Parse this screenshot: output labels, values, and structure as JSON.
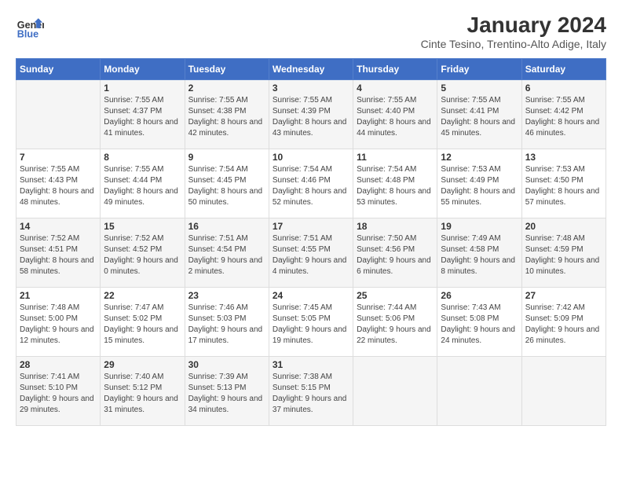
{
  "header": {
    "logo_general": "General",
    "logo_blue": "Blue",
    "month_title": "January 2024",
    "location": "Cinte Tesino, Trentino-Alto Adige, Italy"
  },
  "weekdays": [
    "Sunday",
    "Monday",
    "Tuesday",
    "Wednesday",
    "Thursday",
    "Friday",
    "Saturday"
  ],
  "weeks": [
    [
      {
        "day": "",
        "sunrise": "",
        "sunset": "",
        "daylight": ""
      },
      {
        "day": "1",
        "sunrise": "Sunrise: 7:55 AM",
        "sunset": "Sunset: 4:37 PM",
        "daylight": "Daylight: 8 hours and 41 minutes."
      },
      {
        "day": "2",
        "sunrise": "Sunrise: 7:55 AM",
        "sunset": "Sunset: 4:38 PM",
        "daylight": "Daylight: 8 hours and 42 minutes."
      },
      {
        "day": "3",
        "sunrise": "Sunrise: 7:55 AM",
        "sunset": "Sunset: 4:39 PM",
        "daylight": "Daylight: 8 hours and 43 minutes."
      },
      {
        "day": "4",
        "sunrise": "Sunrise: 7:55 AM",
        "sunset": "Sunset: 4:40 PM",
        "daylight": "Daylight: 8 hours and 44 minutes."
      },
      {
        "day": "5",
        "sunrise": "Sunrise: 7:55 AM",
        "sunset": "Sunset: 4:41 PM",
        "daylight": "Daylight: 8 hours and 45 minutes."
      },
      {
        "day": "6",
        "sunrise": "Sunrise: 7:55 AM",
        "sunset": "Sunset: 4:42 PM",
        "daylight": "Daylight: 8 hours and 46 minutes."
      }
    ],
    [
      {
        "day": "7",
        "sunrise": "Sunrise: 7:55 AM",
        "sunset": "Sunset: 4:43 PM",
        "daylight": "Daylight: 8 hours and 48 minutes."
      },
      {
        "day": "8",
        "sunrise": "Sunrise: 7:55 AM",
        "sunset": "Sunset: 4:44 PM",
        "daylight": "Daylight: 8 hours and 49 minutes."
      },
      {
        "day": "9",
        "sunrise": "Sunrise: 7:54 AM",
        "sunset": "Sunset: 4:45 PM",
        "daylight": "Daylight: 8 hours and 50 minutes."
      },
      {
        "day": "10",
        "sunrise": "Sunrise: 7:54 AM",
        "sunset": "Sunset: 4:46 PM",
        "daylight": "Daylight: 8 hours and 52 minutes."
      },
      {
        "day": "11",
        "sunrise": "Sunrise: 7:54 AM",
        "sunset": "Sunset: 4:48 PM",
        "daylight": "Daylight: 8 hours and 53 minutes."
      },
      {
        "day": "12",
        "sunrise": "Sunrise: 7:53 AM",
        "sunset": "Sunset: 4:49 PM",
        "daylight": "Daylight: 8 hours and 55 minutes."
      },
      {
        "day": "13",
        "sunrise": "Sunrise: 7:53 AM",
        "sunset": "Sunset: 4:50 PM",
        "daylight": "Daylight: 8 hours and 57 minutes."
      }
    ],
    [
      {
        "day": "14",
        "sunrise": "Sunrise: 7:52 AM",
        "sunset": "Sunset: 4:51 PM",
        "daylight": "Daylight: 8 hours and 58 minutes."
      },
      {
        "day": "15",
        "sunrise": "Sunrise: 7:52 AM",
        "sunset": "Sunset: 4:52 PM",
        "daylight": "Daylight: 9 hours and 0 minutes."
      },
      {
        "day": "16",
        "sunrise": "Sunrise: 7:51 AM",
        "sunset": "Sunset: 4:54 PM",
        "daylight": "Daylight: 9 hours and 2 minutes."
      },
      {
        "day": "17",
        "sunrise": "Sunrise: 7:51 AM",
        "sunset": "Sunset: 4:55 PM",
        "daylight": "Daylight: 9 hours and 4 minutes."
      },
      {
        "day": "18",
        "sunrise": "Sunrise: 7:50 AM",
        "sunset": "Sunset: 4:56 PM",
        "daylight": "Daylight: 9 hours and 6 minutes."
      },
      {
        "day": "19",
        "sunrise": "Sunrise: 7:49 AM",
        "sunset": "Sunset: 4:58 PM",
        "daylight": "Daylight: 9 hours and 8 minutes."
      },
      {
        "day": "20",
        "sunrise": "Sunrise: 7:48 AM",
        "sunset": "Sunset: 4:59 PM",
        "daylight": "Daylight: 9 hours and 10 minutes."
      }
    ],
    [
      {
        "day": "21",
        "sunrise": "Sunrise: 7:48 AM",
        "sunset": "Sunset: 5:00 PM",
        "daylight": "Daylight: 9 hours and 12 minutes."
      },
      {
        "day": "22",
        "sunrise": "Sunrise: 7:47 AM",
        "sunset": "Sunset: 5:02 PM",
        "daylight": "Daylight: 9 hours and 15 minutes."
      },
      {
        "day": "23",
        "sunrise": "Sunrise: 7:46 AM",
        "sunset": "Sunset: 5:03 PM",
        "daylight": "Daylight: 9 hours and 17 minutes."
      },
      {
        "day": "24",
        "sunrise": "Sunrise: 7:45 AM",
        "sunset": "Sunset: 5:05 PM",
        "daylight": "Daylight: 9 hours and 19 minutes."
      },
      {
        "day": "25",
        "sunrise": "Sunrise: 7:44 AM",
        "sunset": "Sunset: 5:06 PM",
        "daylight": "Daylight: 9 hours and 22 minutes."
      },
      {
        "day": "26",
        "sunrise": "Sunrise: 7:43 AM",
        "sunset": "Sunset: 5:08 PM",
        "daylight": "Daylight: 9 hours and 24 minutes."
      },
      {
        "day": "27",
        "sunrise": "Sunrise: 7:42 AM",
        "sunset": "Sunset: 5:09 PM",
        "daylight": "Daylight: 9 hours and 26 minutes."
      }
    ],
    [
      {
        "day": "28",
        "sunrise": "Sunrise: 7:41 AM",
        "sunset": "Sunset: 5:10 PM",
        "daylight": "Daylight: 9 hours and 29 minutes."
      },
      {
        "day": "29",
        "sunrise": "Sunrise: 7:40 AM",
        "sunset": "Sunset: 5:12 PM",
        "daylight": "Daylight: 9 hours and 31 minutes."
      },
      {
        "day": "30",
        "sunrise": "Sunrise: 7:39 AM",
        "sunset": "Sunset: 5:13 PM",
        "daylight": "Daylight: 9 hours and 34 minutes."
      },
      {
        "day": "31",
        "sunrise": "Sunrise: 7:38 AM",
        "sunset": "Sunset: 5:15 PM",
        "daylight": "Daylight: 9 hours and 37 minutes."
      },
      {
        "day": "",
        "sunrise": "",
        "sunset": "",
        "daylight": ""
      },
      {
        "day": "",
        "sunrise": "",
        "sunset": "",
        "daylight": ""
      },
      {
        "day": "",
        "sunrise": "",
        "sunset": "",
        "daylight": ""
      }
    ]
  ]
}
